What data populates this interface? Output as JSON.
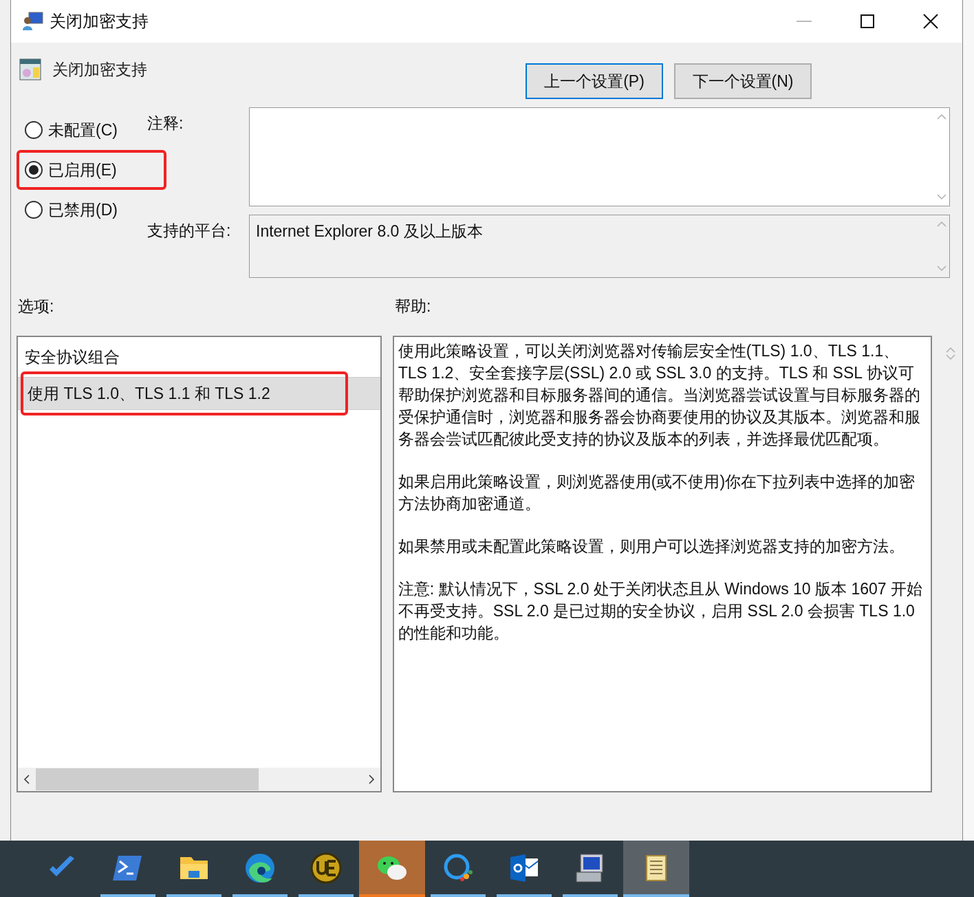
{
  "window": {
    "title": "关闭加密支持"
  },
  "policy": {
    "title": "关闭加密支持"
  },
  "nav_buttons": [
    {
      "label": "上一个设置(P)",
      "selected": true
    },
    {
      "label": "下一个设置(N)",
      "selected": false
    }
  ],
  "states": [
    {
      "label": "未配置(C)",
      "selected": false,
      "highlighted": false
    },
    {
      "label": "已启用(E)",
      "selected": true,
      "highlighted": true
    },
    {
      "label": "已禁用(D)",
      "selected": false,
      "highlighted": false
    }
  ],
  "comment": {
    "label": "注释:"
  },
  "platform": {
    "label": "支持的平台:",
    "value": "Internet Explorer 8.0 及以上版本"
  },
  "options": {
    "label": "选项:",
    "heading": "安全协议组合",
    "rows": [
      {
        "value": "使用 TLS 1.0、TLS 1.1 和 TLS 1.2",
        "selected": true,
        "highlighted": true
      }
    ]
  },
  "help": {
    "label": "帮助:",
    "paragraphs": [
      "使用此策略设置，可以关闭浏览器对传输层安全性(TLS) 1.0、TLS 1.1、TLS 1.2、安全套接字层(SSL) 2.0 或 SSL 3.0 的支持。TLS 和 SSL 协议可帮助保护浏览器和目标服务器间的通信。当浏览器尝试设置与目标服务器的受保护通信时，浏览器和服务器会协商要使用的协议及其版本。浏览器和服务器会尝试匹配彼此受支持的协议及版本的列表，并选择最优匹配项。",
      "如果启用此策略设置，则浏览器使用(或不使用)你在下拉列表中选择的加密方法协商加密通道。",
      "如果禁用或未配置此策略设置，则用户可以选择浏览器支持的加密方法。",
      "注意: 默认情况下，SSL 2.0 处于关闭状态且从 Windows 10 版本 1607 开始不再受支持。SSL 2.0 是已过期的安全协议，启用 SSL 2.0 会损害 TLS 1.0 的性能和功能。"
    ]
  },
  "taskbar": [
    {
      "kind": "todo",
      "running": false,
      "flashing": false,
      "selected": false
    },
    {
      "kind": "terminal",
      "running": true,
      "flashing": false,
      "selected": false
    },
    {
      "kind": "folder",
      "running": true,
      "flashing": false,
      "selected": false
    },
    {
      "kind": "browser",
      "running": true,
      "flashing": false,
      "selected": false
    },
    {
      "kind": "editor",
      "running": true,
      "flashing": false,
      "selected": false
    },
    {
      "kind": "chat",
      "running": true,
      "flashing": true,
      "selected": false
    },
    {
      "kind": "bubble",
      "running": true,
      "flashing": false,
      "selected": false
    },
    {
      "kind": "mail",
      "running": true,
      "flashing": false,
      "selected": false
    },
    {
      "kind": "computer",
      "running": true,
      "flashing": false,
      "selected": false
    },
    {
      "kind": "scroll",
      "running": true,
      "flashing": false,
      "selected": true
    }
  ]
}
